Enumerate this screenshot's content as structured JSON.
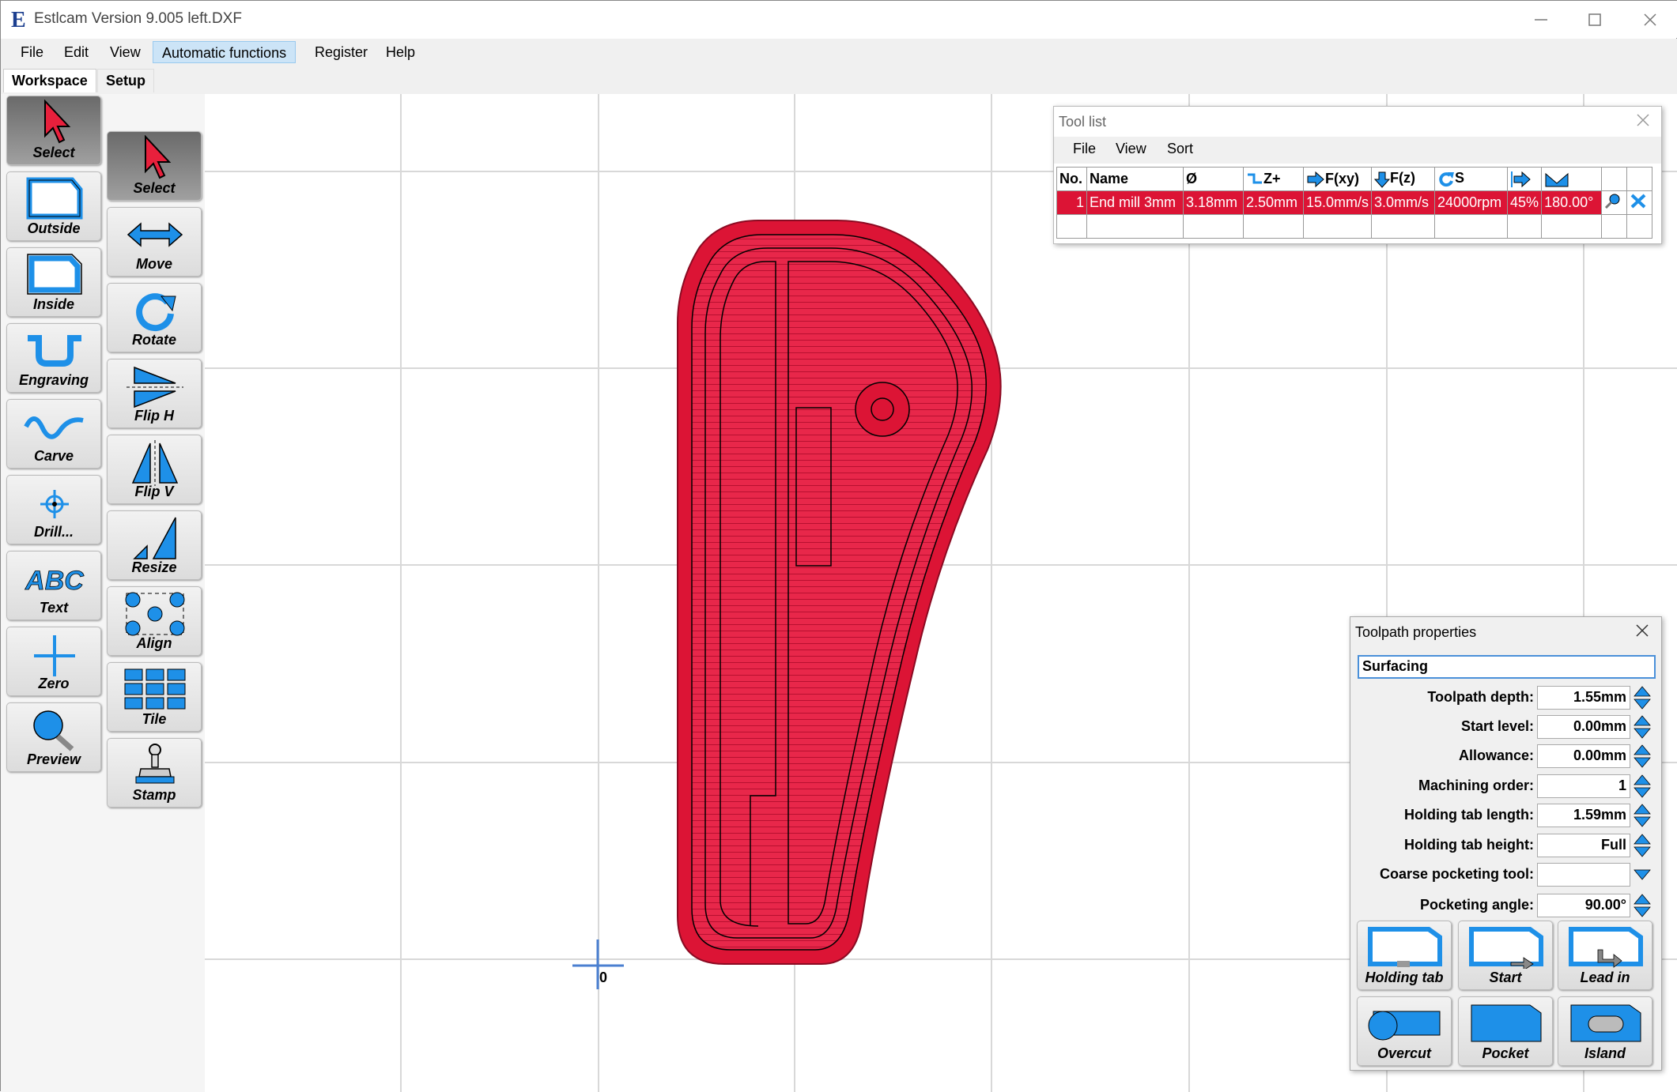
{
  "window": {
    "title": "Estlcam Version 9.005 left.DXF"
  },
  "menu": [
    "File",
    "Edit",
    "View",
    "Automatic functions",
    "Register",
    "Help"
  ],
  "tabs": [
    "Workspace",
    "Setup"
  ],
  "left_tools_col1": [
    "Select",
    "Outside",
    "Inside",
    "Engraving",
    "Carve",
    "Drill...",
    "Text",
    "Zero",
    "Preview"
  ],
  "left_tools_col2": [
    "Select",
    "Move",
    "Rotate",
    "Flip H",
    "Flip V",
    "Resize",
    "Align",
    "Tile",
    "Stamp"
  ],
  "canvas": {
    "origin_label": "0"
  },
  "tool_list": {
    "title": "Tool list",
    "menu": [
      "File",
      "View",
      "Sort"
    ],
    "headers": [
      "No.",
      "Name",
      "Ø",
      "Z+",
      "F(xy)",
      "F(z)",
      "S",
      "",
      ""
    ],
    "rows": [
      {
        "no": "1",
        "name": "End mill 3mm",
        "dia": "3.18mm",
        "zplus": "2.50mm",
        "fxy": "15.0mm/s",
        "fz": "3.0mm/s",
        "s": "24000rpm",
        "pct": "45%",
        "angle": "180.00°"
      }
    ]
  },
  "toolpath_properties": {
    "title": "Toolpath properties",
    "name": "Surfacing",
    "fields": [
      {
        "label": "Toolpath depth:",
        "value": "1.55mm"
      },
      {
        "label": "Start level:",
        "value": "0.00mm"
      },
      {
        "label": "Allowance:",
        "value": "0.00mm"
      },
      {
        "label": "Machining order:",
        "value": "1"
      },
      {
        "label": "Holding tab length:",
        "value": "1.59mm"
      },
      {
        "label": "Holding tab height:",
        "value": "Full"
      },
      {
        "label": "Coarse pocketing tool:",
        "value": ""
      },
      {
        "label": "Pocketing angle:",
        "value": "90.00°"
      }
    ],
    "buttons": [
      "Holding tab",
      "Start",
      "Lead in",
      "Overcut",
      "Pocket",
      "Island"
    ]
  },
  "colors": {
    "accent": "#1e90e8",
    "toolpath_red": "#dc1435",
    "selected_row": "#dc1435"
  }
}
